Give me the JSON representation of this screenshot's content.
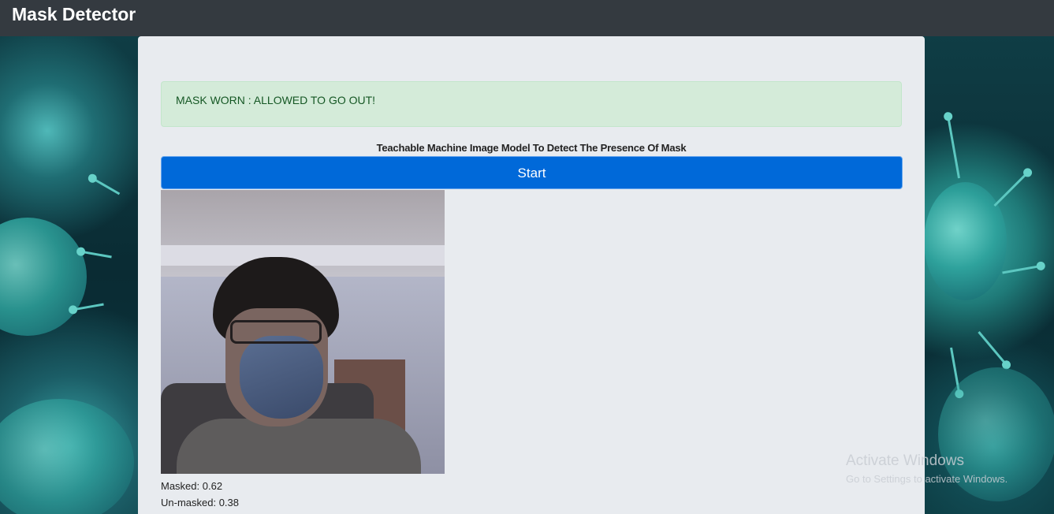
{
  "navbar": {
    "brand": "Mask Detector"
  },
  "alert": {
    "text": "MASK WORN : ALLOWED TO GO OUT!",
    "color": "#d4ebd9"
  },
  "main": {
    "heading": "Teachable Machine Image Model To Detect The Presence Of Mask",
    "start_button": "Start",
    "predictions": [
      {
        "text": "Masked: 0.62"
      },
      {
        "text": "Un-masked: 0.38"
      }
    ]
  },
  "watermark": {
    "title": "Activate Windows",
    "subtitle": "Go to Settings to activate Windows."
  },
  "colors": {
    "navbar": "#343a40",
    "button": "#0069d9",
    "container": "#e8ebef"
  }
}
